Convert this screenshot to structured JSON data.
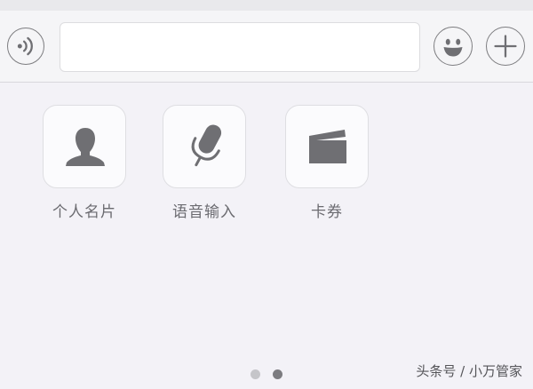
{
  "input_bar": {
    "voice_icon": "voice-wave-icon",
    "text_value": "",
    "emoji_icon": "emoji-smile-icon",
    "plus_icon": "plus-icon"
  },
  "tools": [
    {
      "label": "个人名片",
      "icon": "person-icon"
    },
    {
      "label": "语音输入",
      "icon": "microphone-icon"
    },
    {
      "label": "卡券",
      "icon": "card-wallet-icon"
    }
  ],
  "pager": {
    "pages": 2,
    "active": 2
  },
  "watermark": "头条号 / 小万管家",
  "colors": {
    "icon": "#6f6f73",
    "background": "#f3f2f7",
    "tile": "#fbfbfd"
  }
}
